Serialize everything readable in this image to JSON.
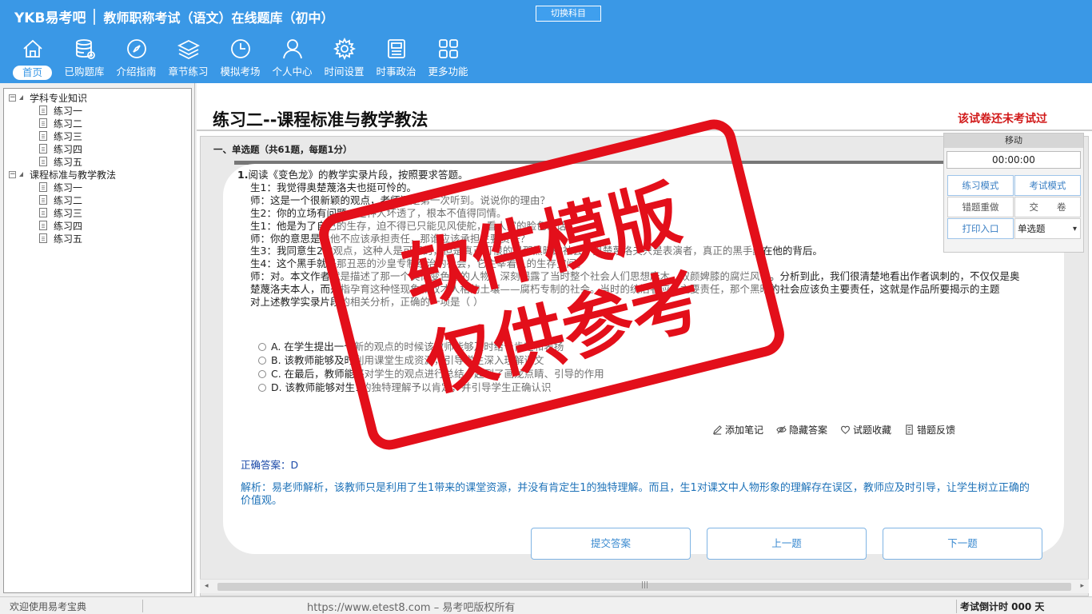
{
  "header": {
    "logo": "YKB易考吧",
    "app_title": "教师职称考试（语文）在线题库（初中）",
    "switch_subject": "切换科目",
    "nav": [
      {
        "label": "首页",
        "icon": "home-icon"
      },
      {
        "label": "已购题库",
        "icon": "database-icon"
      },
      {
        "label": "介绍指南",
        "icon": "compass-icon"
      },
      {
        "label": "章节练习",
        "icon": "layers-icon"
      },
      {
        "label": "模拟考场",
        "icon": "clock-icon"
      },
      {
        "label": "个人中心",
        "icon": "user-icon"
      },
      {
        "label": "时间设置",
        "icon": "gear-icon"
      },
      {
        "label": "时事政治",
        "icon": "news-icon"
      },
      {
        "label": "更多功能",
        "icon": "grid-icon"
      }
    ]
  },
  "tree": {
    "groups": [
      {
        "label": "学科专业知识",
        "items": [
          "练习一",
          "练习二",
          "练习三",
          "练习四",
          "练习五"
        ]
      },
      {
        "label": "课程标准与教学教法",
        "items": [
          "练习一",
          "练习二",
          "练习三",
          "练习四",
          "练习五"
        ]
      }
    ]
  },
  "exam": {
    "title": "练习二--课程标准与教学教法",
    "status": "该试卷还未考试过",
    "section": "一、单选题（共61题，每题1分）"
  },
  "question": {
    "number": "1.",
    "lines": [
      "阅读《变色龙》的教学实录片段，按照要求答题。",
      "生1：我觉得奥楚蔑洛夫也挺可怜的。",
      "师：这是一个很新颖的观点，老师还是第一次听到。说说你的理由？",
      "生2：你的立场有问题，这种人坏透了，根本不值得同情。",
      "生1：他是为了自己的生存，迫不得已只能见风使舵，看人家的脸色说话。",
      "师：你的意思是说他不应该承担责任，那谁应该承担主要责任？",
      "生3：我同意生2的观点，这种人是可恶的，但是真正可恨的是那黑暗的社会。奥楚蔑洛夫只是表演者，真正的黑手藏在他的背后。",
      "生4：这个黑手就是那丑恶的沙皇专制统治的社会，它主宰着人的生存空间。",
      "师：对。本文作者就是描述了那一个类似变色龙的人物，深刻揭露了当时整个社会人们思想麻木、奴颜婢膝的腐烂风气。分析到此，我们很清楚地看出作者讽刺的，不仅仅是奥楚蔑洛夫本人，而是指孕育这种怪现象和奴才人格的土壤——腐朽专制的社会。当时的统治者应负主要责任，那个黑暗的社会应该负主要责任，这就是作品所要揭示的主题",
      "对上述教学实录片段的相关分析，正确的一项是（ ）"
    ],
    "options": [
      "A. 在学生提出一个新的观点的时候该教师能够及时给予肯定和表扬",
      "B. 该教师能够及时利用课堂生成资源，引导学生深入理解课文",
      "C. 在最后，教师能够对学生的观点进行总结，起到了画龙点睛、引导的作用",
      "D. 该教师能够对生1的独特理解予以肯定，并引导学生正确认识"
    ],
    "tools": [
      {
        "label": "添加笔记",
        "icon": "pencil-icon"
      },
      {
        "label": "隐藏答案",
        "icon": "eye-off-icon"
      },
      {
        "label": "试题收藏",
        "icon": "heart-icon"
      },
      {
        "label": "错题反馈",
        "icon": "feedback-icon"
      }
    ],
    "answer": "正确答案：D",
    "analysis": "解析：易老师解析，该教师只是利用了生1带来的课堂资源，并没有肯定生1的独特理解。而且，生1对课文中人物形象的理解存在误区，教师应及时引导，让学生树立正确的价值观。"
  },
  "buttons": {
    "submit": "提交答案",
    "prev": "上一题",
    "next": "下一题"
  },
  "panel": {
    "move": "移动",
    "timer": "00:00:00",
    "practice_mode": "练习模式",
    "exam_mode": "考试模式",
    "redo_wrong": "错题重做",
    "hand_in": "交　　卷",
    "print": "打印入口",
    "type_select": "单选题"
  },
  "stamp": {
    "line1": "软件模版",
    "line2": "仅供参考",
    "color": "#e30f1a"
  },
  "footer": {
    "welcome": "欢迎使用易考宝典",
    "copyright": "https://www.etest8.com – 易考吧版权所有",
    "countdown": "考试倒计时 000 天"
  },
  "colors": {
    "header_bg": "#3a98e6",
    "status_red": "#d11a1a",
    "analysis_blue": "#1e72b8"
  }
}
